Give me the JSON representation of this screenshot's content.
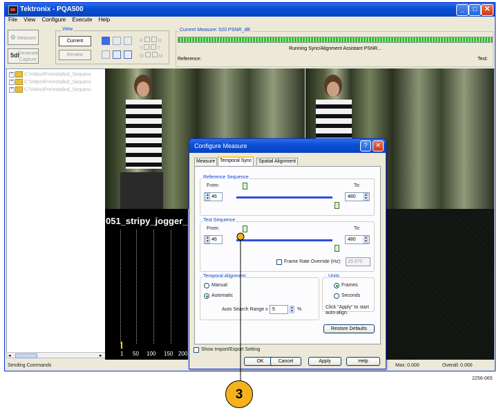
{
  "window": {
    "title": "Tektronix - PQA500"
  },
  "menu": [
    "File",
    "View",
    "Configure",
    "Execute",
    "Help"
  ],
  "toolbar": {
    "measure_label": "Measure",
    "generate_label": "Generate",
    "capture_label": "Capture",
    "view_group_label": "View",
    "current_label": "Current",
    "review_label": "Review",
    "flags": [
      "R",
      "T",
      "M"
    ]
  },
  "measure_status": {
    "current_measure": "Current Measure: 020 PSNR_dB",
    "running_text": "Running Sync/Alignment Assistant PSNR...",
    "reference_label": "Reference:",
    "test_label": "Test:"
  },
  "tree": {
    "items": [
      "C:\\Video\\PreInstalled_Sequenc",
      "C:\\Video\\PreInstalled_Sequenc",
      "C:\\Video\\PreInstalled_Sequenc"
    ]
  },
  "video": {
    "overlay_title": "051_stripy_jogger_",
    "axis_labels": [
      "1",
      "1",
      "50",
      "100",
      "150",
      "200"
    ]
  },
  "statusbar": {
    "left": "Sending Commands",
    "max": "Max: 0.000",
    "overall": "Overall: 0.000"
  },
  "dialog": {
    "title": "Configure Measure",
    "tabs": [
      "Measure",
      "Temporal Sync",
      "Spatial Alignment"
    ],
    "reference_sequence": {
      "label": "Reference Sequence",
      "from_label": "From:",
      "to_label": "To:",
      "from": "46",
      "to": "480"
    },
    "test_sequence": {
      "label": "Test Sequence",
      "from_label": "From:",
      "to_label": "To:",
      "from": "46",
      "to": "480"
    },
    "frame_rate": {
      "label": "Frame Rate Override (Hz):",
      "value": "29.970",
      "checked": false
    },
    "temporal_alignment": {
      "label": "Temporal Alignment",
      "manual": "Manual",
      "automatic": "Automatic",
      "auto_search_label": "Auto Search Range ±",
      "auto_search_value": "5",
      "unit": "%"
    },
    "units": {
      "label": "Units",
      "frames": "Frames",
      "seconds": "Seconds",
      "hint": "Click \"Apply\" to start auto-align."
    },
    "restore_defaults": "Restore Defaults",
    "show_import_export": "Show Import/Export Setting",
    "buttons": {
      "ok": "OK",
      "cancel": "Cancel",
      "apply": "Apply",
      "help": "Help"
    }
  },
  "callout": {
    "number": "3"
  },
  "figure_id": "2256-065",
  "colors": {
    "titlebar": "#0a4fd6",
    "progress": "#2fc02f",
    "callout": "#f7b21b"
  }
}
